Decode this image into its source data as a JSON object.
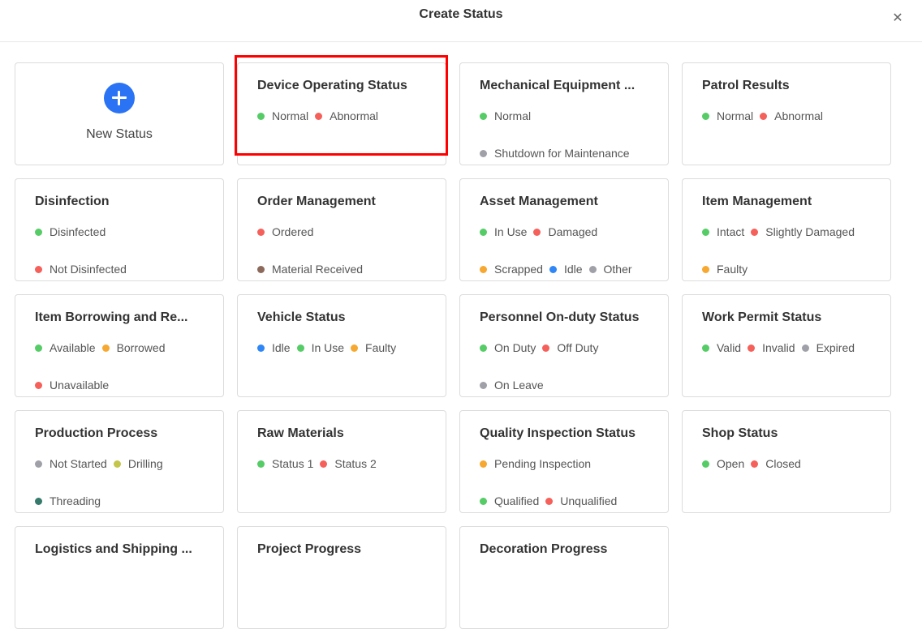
{
  "header": {
    "title": "Create Status",
    "close_icon": "close-icon"
  },
  "new_status": {
    "label": "New Status",
    "icon": "plus-circle-icon",
    "icon_color": "#2a73f5"
  },
  "colors": {
    "green": "#55cc66",
    "red": "#f5605a",
    "gray": "#a0a0a8",
    "orange": "#f6a830",
    "blue": "#2f86f6",
    "brown": "#8b6a5c",
    "olive": "#c3c64a",
    "teal": "#357a6a",
    "highlight": "#ff0000"
  },
  "highlighted_card": "Device Operating Status",
  "cards": [
    {
      "title": "Device Operating Status",
      "statuses": [
        {
          "label": "Normal",
          "color": "green"
        },
        {
          "label": "Abnormal",
          "color": "red"
        }
      ]
    },
    {
      "title": "Mechanical Equipment ...",
      "statuses": [
        {
          "label": "Normal",
          "color": "green"
        },
        {
          "label": "Shutdown for Maintenance",
          "color": "gray"
        }
      ]
    },
    {
      "title": "Patrol Results",
      "statuses": [
        {
          "label": "Normal",
          "color": "green"
        },
        {
          "label": "Abnormal",
          "color": "red"
        }
      ]
    },
    {
      "title": "Disinfection",
      "statuses": [
        {
          "label": "Disinfected",
          "color": "green"
        },
        {
          "label": "Not Disinfected",
          "color": "red"
        }
      ]
    },
    {
      "title": "Order Management",
      "statuses": [
        {
          "label": "Ordered",
          "color": "red"
        },
        {
          "label": "Material Received",
          "color": "brown"
        }
      ]
    },
    {
      "title": "Asset Management",
      "statuses": [
        {
          "label": "In Use",
          "color": "green"
        },
        {
          "label": "Damaged",
          "color": "red"
        },
        {
          "label": "Scrapped",
          "color": "orange"
        },
        {
          "label": "Idle",
          "color": "blue"
        },
        {
          "label": "Other",
          "color": "gray"
        }
      ]
    },
    {
      "title": "Item Management",
      "statuses": [
        {
          "label": "Intact",
          "color": "green"
        },
        {
          "label": "Slightly Damaged",
          "color": "red"
        },
        {
          "label": "Faulty",
          "color": "orange"
        }
      ]
    },
    {
      "title": "Item Borrowing and Re...",
      "statuses": [
        {
          "label": "Available",
          "color": "green"
        },
        {
          "label": "Borrowed",
          "color": "orange"
        },
        {
          "label": "Unavailable",
          "color": "red"
        }
      ]
    },
    {
      "title": "Vehicle Status",
      "statuses": [
        {
          "label": "Idle",
          "color": "blue"
        },
        {
          "label": "In Use",
          "color": "green"
        },
        {
          "label": "Faulty",
          "color": "orange"
        }
      ]
    },
    {
      "title": "Personnel On-duty Status",
      "statuses": [
        {
          "label": "On Duty",
          "color": "green"
        },
        {
          "label": "Off Duty",
          "color": "red"
        },
        {
          "label": "On Leave",
          "color": "gray"
        }
      ]
    },
    {
      "title": "Work Permit Status",
      "statuses": [
        {
          "label": "Valid",
          "color": "green"
        },
        {
          "label": "Invalid",
          "color": "red"
        },
        {
          "label": "Expired",
          "color": "gray"
        }
      ]
    },
    {
      "title": "Production Process",
      "statuses": [
        {
          "label": "Not Started",
          "color": "gray"
        },
        {
          "label": "Drilling",
          "color": "olive"
        },
        {
          "label": "Threading",
          "color": "teal"
        }
      ]
    },
    {
      "title": "Raw Materials",
      "statuses": [
        {
          "label": "Status 1",
          "color": "green"
        },
        {
          "label": "Status 2",
          "color": "red"
        }
      ]
    },
    {
      "title": "Quality Inspection Status",
      "statuses": [
        {
          "label": "Pending Inspection",
          "color": "orange"
        },
        {
          "label": "Qualified",
          "color": "green"
        },
        {
          "label": "Unqualified",
          "color": "red"
        }
      ]
    },
    {
      "title": "Shop Status",
      "statuses": [
        {
          "label": "Open",
          "color": "green"
        },
        {
          "label": "Closed",
          "color": "red"
        }
      ]
    },
    {
      "title": "Logistics and Shipping ...",
      "statuses": []
    },
    {
      "title": "Project Progress",
      "statuses": []
    },
    {
      "title": "Decoration Progress",
      "statuses": []
    }
  ]
}
